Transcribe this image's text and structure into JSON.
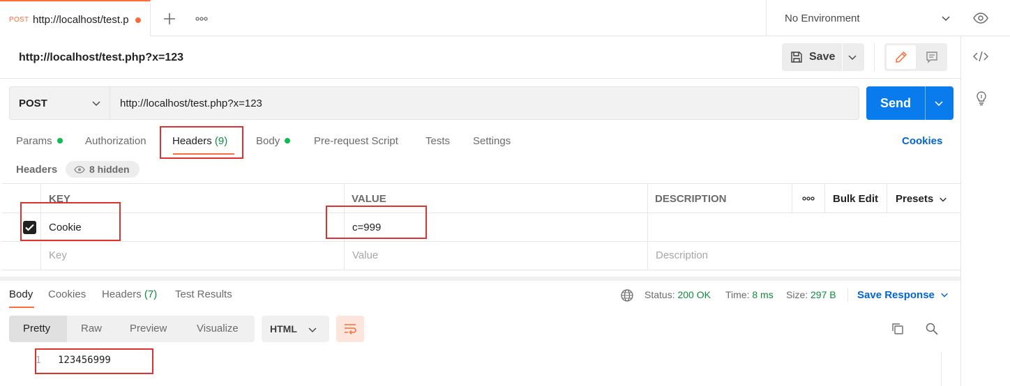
{
  "tabbar": {
    "active_tab": {
      "method": "POST",
      "url": "http://localhost/test.p"
    },
    "environment": "No Environment"
  },
  "request": {
    "title": "http://localhost/test.php?x=123",
    "save_label": "Save",
    "method": "POST",
    "url": "http://localhost/test.php?x=123",
    "send_label": "Send"
  },
  "request_tabs": {
    "params": "Params",
    "authorization": "Authorization",
    "headers": "Headers",
    "headers_count": "(9)",
    "body": "Body",
    "prerequest": "Pre-request Script",
    "tests": "Tests",
    "settings": "Settings",
    "cookies": "Cookies"
  },
  "headers_section": {
    "heading": "Headers",
    "hidden": "8 hidden",
    "columns": {
      "key": "KEY",
      "value": "VALUE",
      "description": "DESCRIPTION"
    },
    "bulk_edit": "Bulk Edit",
    "presets": "Presets",
    "rows": [
      {
        "checked": true,
        "key": "Cookie",
        "value": "c=999",
        "description": ""
      }
    ],
    "placeholders": {
      "key": "Key",
      "value": "Value",
      "description": "Description"
    }
  },
  "response": {
    "tabs": {
      "body": "Body",
      "cookies": "Cookies",
      "headers": "Headers",
      "headers_count": "(7)",
      "test_results": "Test Results"
    },
    "status_label": "Status:",
    "status_value": "200 OK",
    "time_label": "Time:",
    "time_value": "8 ms",
    "size_label": "Size:",
    "size_value": "297 B",
    "save_response": "Save Response",
    "formats": [
      "Pretty",
      "Raw",
      "Preview",
      "Visualize"
    ],
    "language": "HTML",
    "line_number": "1",
    "body_line": "123456999"
  },
  "colors": {
    "accent": "#ff6c37",
    "send": "#097bed",
    "link": "#0265d2",
    "success": "#0f8a3c",
    "annotation": "#e03131"
  }
}
